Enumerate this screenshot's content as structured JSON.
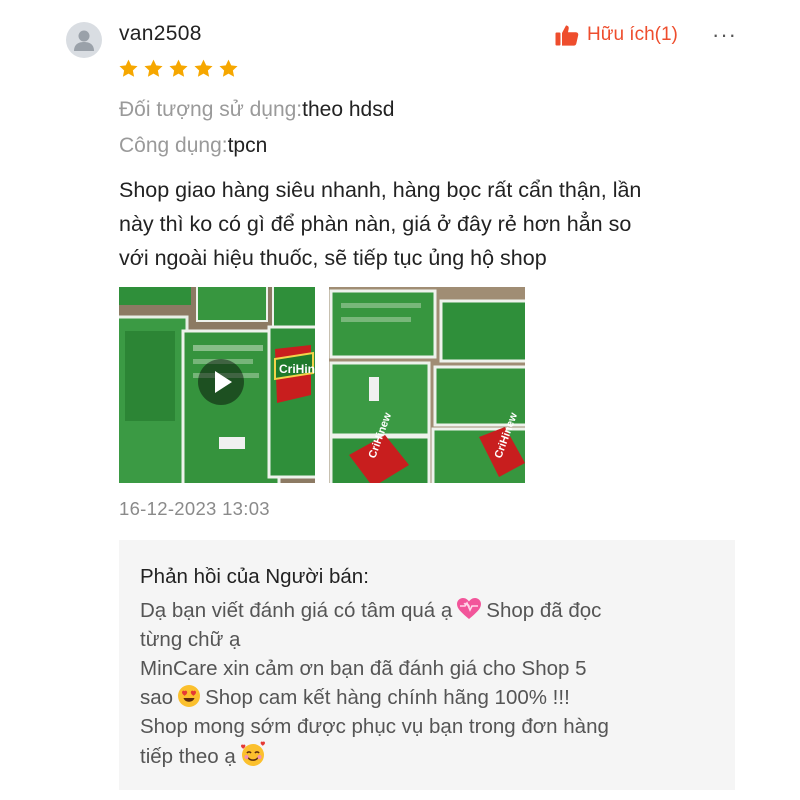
{
  "review": {
    "username": "van2508",
    "rating": 5,
    "max_rating": 5,
    "helpful_label": "Hữu ích(1)",
    "more_label": "···",
    "attributes": [
      {
        "label": "Đối tượng sử dụng:",
        "value": "theo hdsd"
      },
      {
        "label": "Công dụng:",
        "value": "tpcn"
      }
    ],
    "text_lines": [
      "Shop giao hàng siêu nhanh, hàng bọc rất cẩn thận, lần",
      "này thì ko có gì để phàn nàn, giá ở đây rẻ hơn hẳn so",
      "với ngoài hiệu thuốc, sẽ tiếp tục ủng hộ shop"
    ],
    "media_brand": "CriHinew",
    "timestamp": "16-12-2023 13:03"
  },
  "seller_reply": {
    "title": "Phản hồi của Người bán:",
    "line1_a": "Dạ bạn viết đánh giá có tâm quá ạ",
    "line1_b": "Shop đã đọc",
    "line2": "từng chữ ạ",
    "line3": "MinCare xin cảm ơn bạn đã đánh giá cho Shop 5",
    "line4_a": "sao",
    "line4_b": "Shop cam kết hàng chính hãng 100% !!!",
    "line5": "Shop mong sớm được phục vụ bạn trong đơn hàng",
    "line6_a": "tiếp theo ạ"
  },
  "colors": {
    "accent": "#ee4d2d",
    "star": "#f6a700",
    "reply_bg": "#f5f5f5",
    "package_green": "#2f8f3a"
  },
  "icons": {
    "avatar": "user-silhouette-icon",
    "helpful": "thumbs-up-icon",
    "more": "more-dots-icon",
    "play": "play-icon",
    "emoji1": "heart-pulse-emoji",
    "emoji2": "heart-eyes-emoji",
    "emoji3": "smiling-face-with-hearts-emoji"
  }
}
